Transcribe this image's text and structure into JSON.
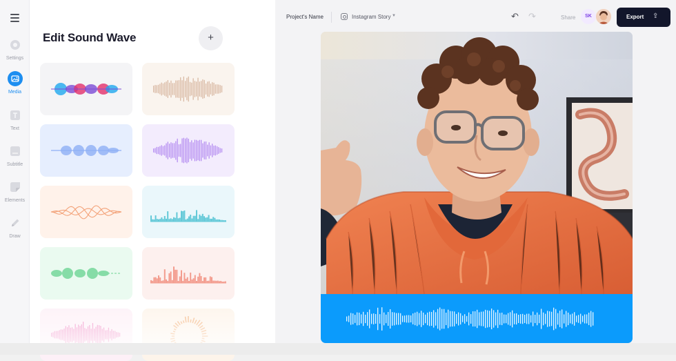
{
  "sidebar": {
    "items": [
      {
        "label": "Settings",
        "icon": "settings-icon"
      },
      {
        "label": "Media",
        "icon": "image-icon",
        "active": true
      },
      {
        "label": "Text",
        "icon": "text-icon"
      },
      {
        "label": "Subtitle",
        "icon": "subtitle-icon"
      },
      {
        "label": "Elements",
        "icon": "elements-icon"
      },
      {
        "label": "Draw",
        "icon": "pencil-icon"
      }
    ]
  },
  "panel": {
    "title": "Edit Sound Wave",
    "add_label": "+",
    "wave_styles": [
      {
        "style": "multicolor-blob",
        "bg": "#f4f4f6",
        "colors": [
          "#1fa8ef",
          "#7c4bd6",
          "#e2306c"
        ]
      },
      {
        "style": "thin-bars",
        "bg": "#faf4ee",
        "colors": [
          "#d9b9a3"
        ]
      },
      {
        "style": "soft-blob",
        "bg": "#e6eefe",
        "colors": [
          "#8eaff5"
        ]
      },
      {
        "style": "spiky-bars",
        "bg": "#f3ecfd",
        "colors": [
          "#b68ef1"
        ]
      },
      {
        "style": "line-sine",
        "bg": "#fff2ea",
        "colors": [
          "#f3a37a"
        ]
      },
      {
        "style": "histogram",
        "bg": "#eaf7fb",
        "colors": [
          "#63c9d8"
        ]
      },
      {
        "style": "dots-blob",
        "bg": "#eafaf0",
        "colors": [
          "#86dca7"
        ]
      },
      {
        "style": "histogram",
        "bg": "#fdf0ee",
        "colors": [
          "#f39c8e"
        ]
      },
      {
        "style": "spiky-bars",
        "bg": "#fdf0f7",
        "colors": [
          "#f085c1"
        ]
      },
      {
        "style": "circular",
        "bg": "#fdf4ea",
        "colors": [
          "#f4b784"
        ]
      }
    ]
  },
  "topbar": {
    "project_name": "Project's Name",
    "format": "Instagram Story",
    "share_label": "Share",
    "avatar_initials": "SK",
    "export_label": "Export"
  },
  "colors": {
    "accent": "#1e8ef0",
    "export_bg": "#12162b",
    "wave_bar_bg": "#0b9bfc"
  }
}
